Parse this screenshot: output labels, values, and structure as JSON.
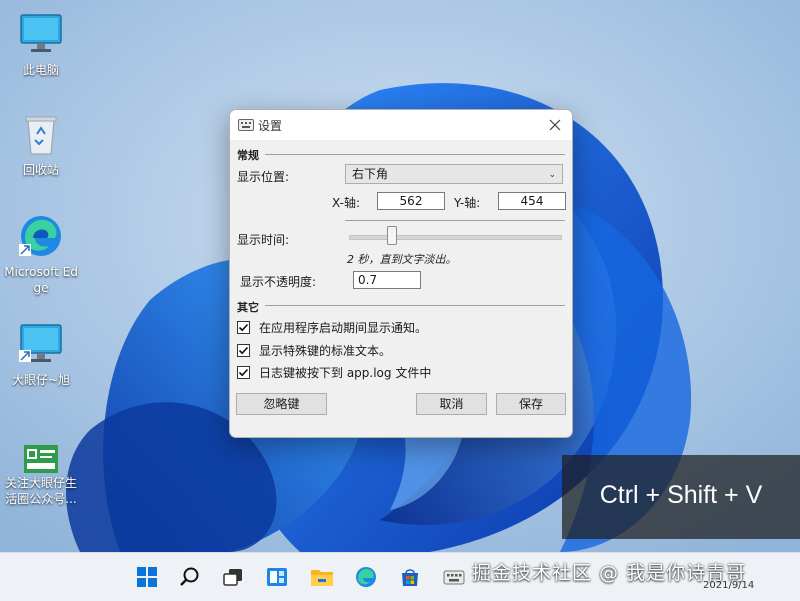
{
  "desktop": {
    "icons": [
      {
        "label": "此电脑",
        "icon": "monitor-icon"
      },
      {
        "label": "回收站",
        "icon": "recycle-bin-icon"
      },
      {
        "label": "Microsoft Edge",
        "icon": "edge-icon"
      },
      {
        "label": "大眼仔~旭",
        "icon": "monitor-shortcut-icon"
      },
      {
        "label": "关注大眼仔生活圈公众号...",
        "icon": "qrcode-icon"
      }
    ]
  },
  "dialog": {
    "title": "设置",
    "title_icon": "keyboard-icon",
    "section_general": "常规",
    "position_label": "显示位置:",
    "position_value": "右下角",
    "x_label": "X-轴:",
    "x_value": "562",
    "y_label": "Y-轴:",
    "y_value": "454",
    "duration_label": "显示时间:",
    "duration_note": "2 秒，直到文字淡出。",
    "duration_slider_fraction": 0.18,
    "opacity_label": "显示不透明度:",
    "opacity_value": "0.7",
    "section_other": "其它",
    "checkboxes": [
      {
        "label": "在应用程序启动期间显示通知。",
        "checked": true
      },
      {
        "label": "显示特殊键的标准文本。",
        "checked": true
      },
      {
        "label": "日志键被按下到 app.log 文件中",
        "checked": true
      }
    ],
    "ignore_keys_button": "忽略键",
    "cancel_button": "取消",
    "save_button": "保存"
  },
  "key_overlay": {
    "text": "Ctrl + Shift + V"
  },
  "taskbar": {
    "icons": [
      "start-icon",
      "search-icon",
      "task-view-icon",
      "widgets-icon",
      "file-explorer-icon",
      "edge-icon",
      "store-icon",
      "keyboard-app-icon"
    ],
    "date": "2021/9/14"
  },
  "watermark": "掘金技术社区 @ 我是你诗青哥",
  "colors": {
    "accent": "#0a5fd6",
    "wallpaper_bg": "#9fc0e0",
    "taskbar_bg": "#eef2f7"
  }
}
